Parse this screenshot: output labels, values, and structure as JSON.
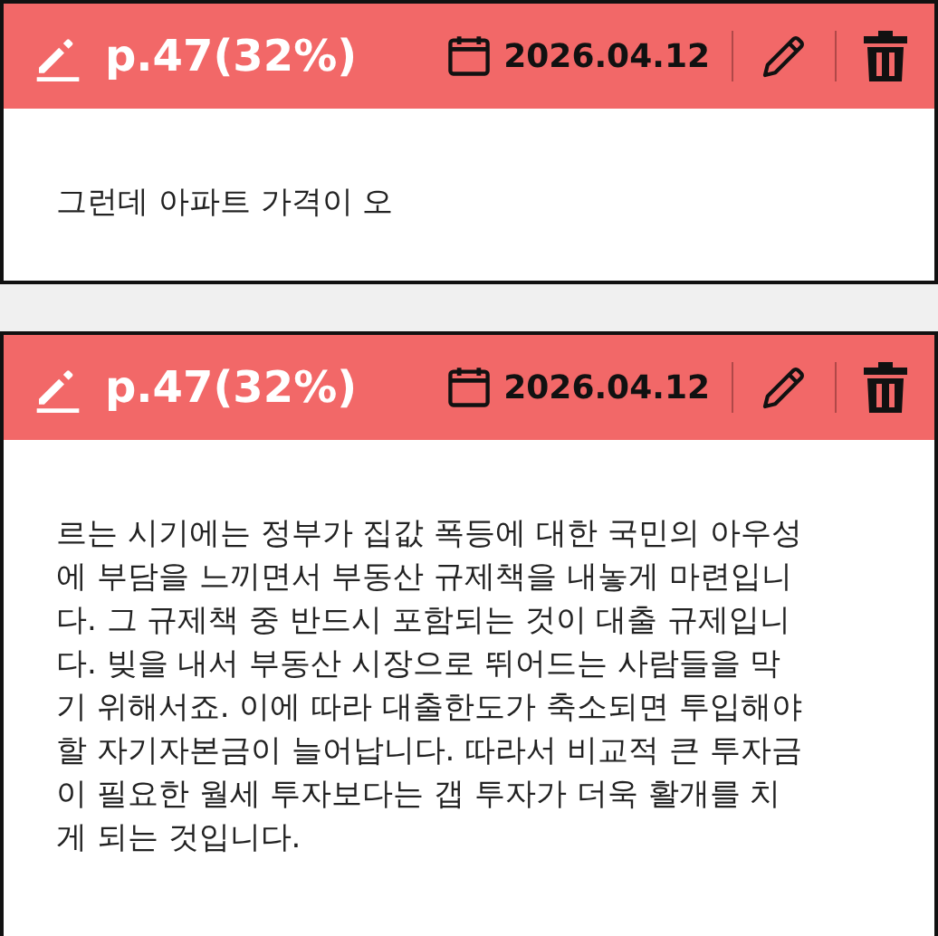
{
  "notes": [
    {
      "title": "p.47(32%)",
      "date": "2026.04.12",
      "text": "그런데 아파트 가격이 오"
    },
    {
      "title": "p.47(32%)",
      "date": "2026.04.12",
      "text": "르는 시기에는 정부가 집값 폭등에 대한 국민의 아우성에 부담을 느끼면서 부동산 규제책을 내놓게 마련입니다. 그 규제책 중 반드시 포함되는 것이 대출 규제입니다. 빚을 내서 부동산 시장으로 뛰어드는 사람들을 막기 위해서죠. 이에 따라 대출한도가 축소되면 투입해야 할 자기자본금이 늘어납니다. 따라서 비교적 큰 투자금이 필요한 월세 투자보다는 갭 투자가 더욱 활개를 치게 되는 것입니다."
    }
  ]
}
